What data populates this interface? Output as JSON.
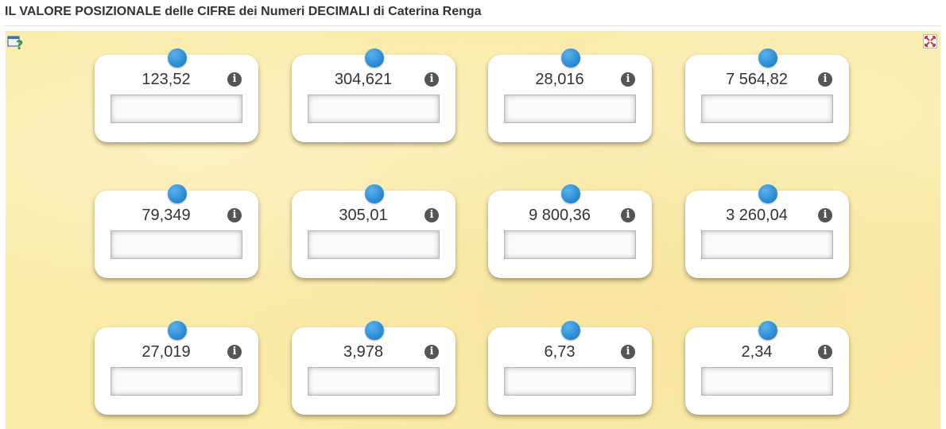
{
  "header": {
    "title_part1": "IL VALORE POSIZIONALE",
    "title_part2": "delle",
    "title_part3": "CIFRE",
    "title_part4": "dei Numeri",
    "title_part5": "DECIMALI",
    "title_part6": "di Caterina Renga"
  },
  "toolbar": {
    "help_icon": "help-question-icon",
    "fullscreen_icon": "fullscreen-toggle-icon"
  },
  "info_glyph": "i",
  "cards": [
    {
      "number": "123,52",
      "answer": ""
    },
    {
      "number": "304,621",
      "answer": ""
    },
    {
      "number": "28,016",
      "answer": ""
    },
    {
      "number": "7 564,82",
      "answer": ""
    },
    {
      "number": "79,349",
      "answer": ""
    },
    {
      "number": "305,01",
      "answer": ""
    },
    {
      "number": "9 800,36",
      "answer": ""
    },
    {
      "number": "3 260,04",
      "answer": ""
    },
    {
      "number": "27,019",
      "answer": ""
    },
    {
      "number": "3,978",
      "answer": ""
    },
    {
      "number": "6,73",
      "answer": ""
    },
    {
      "number": "2,34",
      "answer": ""
    }
  ],
  "colors": {
    "board": "#fbeba8",
    "pin": "#2f8fd7",
    "info": "#555555"
  }
}
